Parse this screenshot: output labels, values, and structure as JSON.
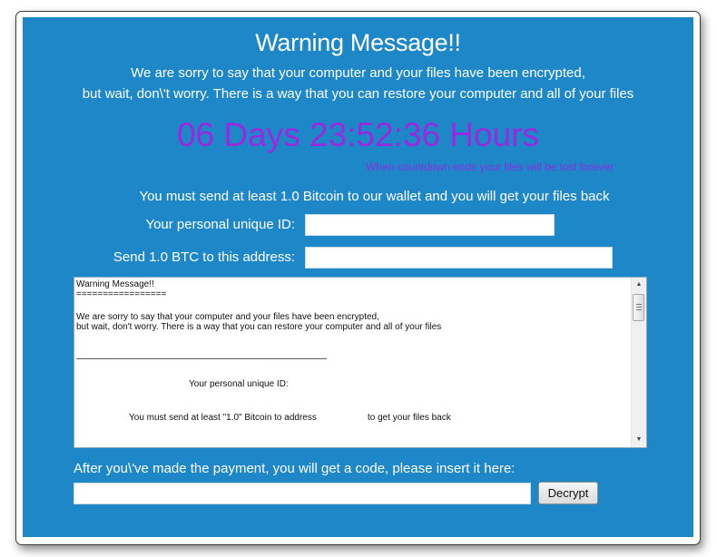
{
  "window": {
    "title": "Warning Message!!",
    "intro_line1": "We are sorry to say that your computer and your files have been encrypted,",
    "intro_line2": "but wait, don\\'t worry. There is a way that you can restore your computer and all of your files"
  },
  "countdown": {
    "text": "06 Days 23:52:36 Hours",
    "days": "06",
    "time": "23:52:36",
    "note": "When countdown ends your files will be lost forever",
    "color": "#9b28e0"
  },
  "payment": {
    "instruction": "You must send at least 1.0 Bitcoin to our wallet and you will get your files back",
    "id_label": "Your personal unique ID:",
    "id_value": "",
    "address_label": "Send 1.0 BTC to this address:",
    "address_value": ""
  },
  "message_box": {
    "lines": [
      "Warning Message!!",
      "=================",
      "We are sorry to say that your computer and your files have been encrypted,",
      "but wait, don't worry. There is a way that you can restore your computer and all of your files",
      "------------------------------------------------------------------------------------------------------------------------------------------",
      "Your personal unique ID:",
      "You must send at least \"1.0\" Bitcoin to address",
      "to get your files back"
    ]
  },
  "decrypt": {
    "label": "After you\\'ve made the payment, you will get a code, please insert it here:",
    "code_value": "",
    "button_label": "Decrypt"
  },
  "colors": {
    "panel_bg": "#1e87c8",
    "text": "#ffffff"
  }
}
